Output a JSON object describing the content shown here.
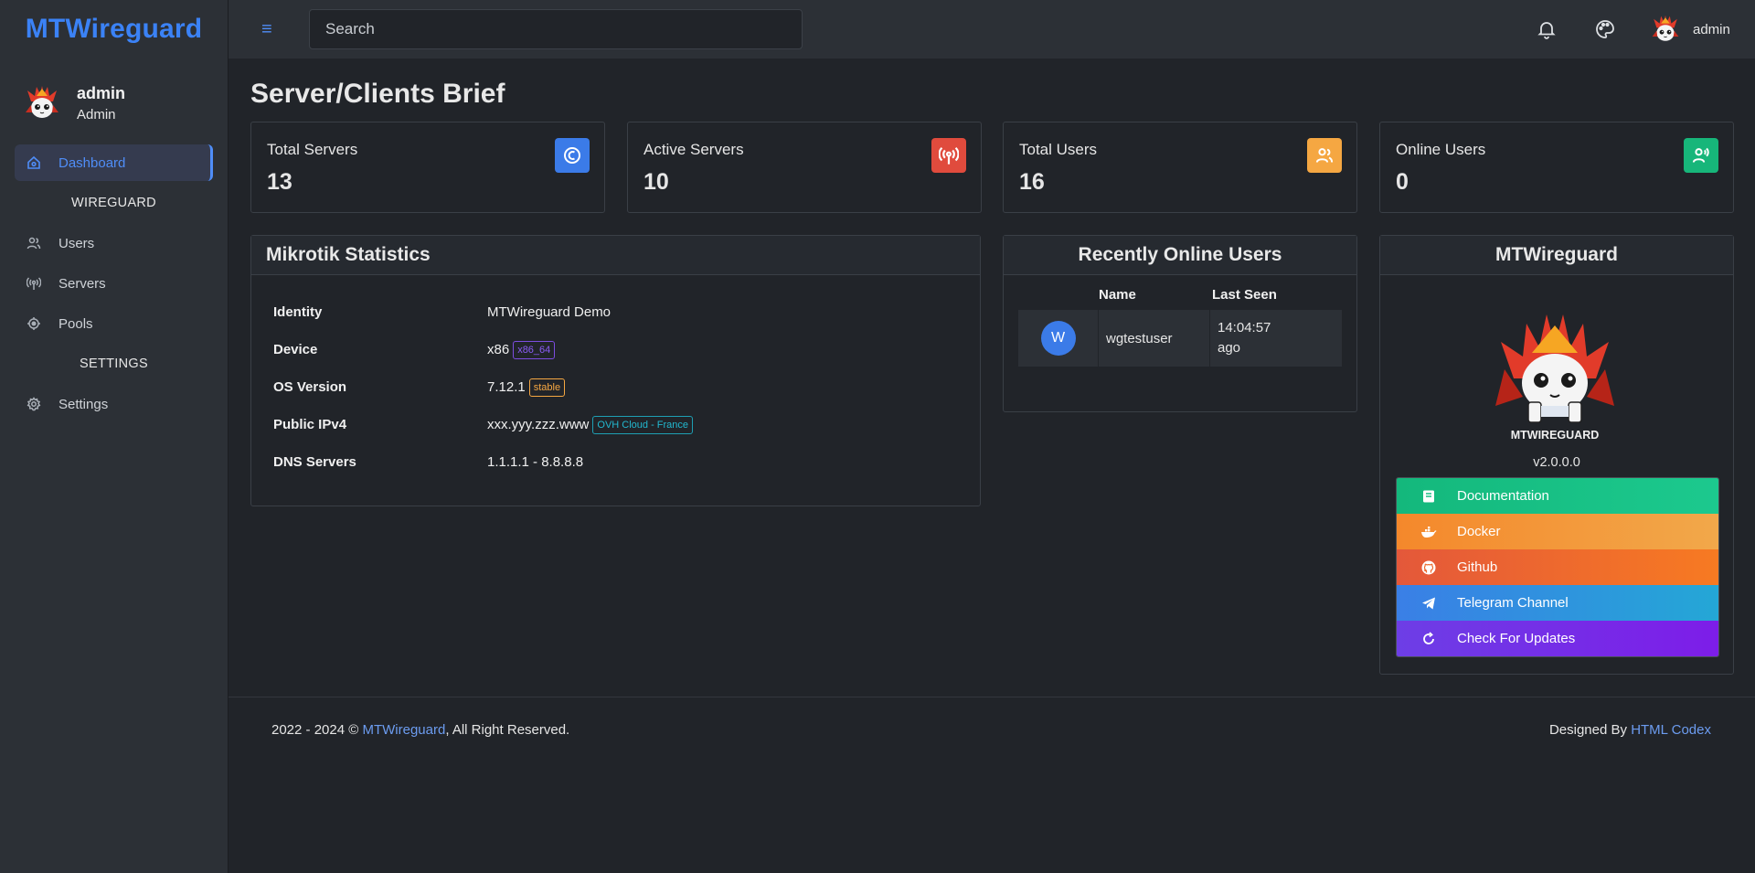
{
  "brand": "MTWireguard",
  "colors": {
    "accent": "#3b82f6",
    "bg": "#212429",
    "panel": "#2c3036"
  },
  "profile": {
    "name": "admin",
    "role": "Admin"
  },
  "nav": {
    "dashboard": "Dashboard",
    "section_wireguard": "WIREGUARD",
    "users": "Users",
    "servers": "Servers",
    "pools": "Pools",
    "section_settings": "SETTINGS",
    "settings": "Settings"
  },
  "topbar": {
    "menu_icon": "≡",
    "search_placeholder": "Search",
    "user": "admin"
  },
  "page_title": "Server/Clients Brief",
  "stats": [
    {
      "label": "Total Servers",
      "value": "13",
      "color": "#3b7be8",
      "icon": "clock-icon"
    },
    {
      "label": "Active Servers",
      "value": "10",
      "color": "#e04b3d",
      "icon": "broadcast-icon"
    },
    {
      "label": "Total Users",
      "value": "16",
      "color": "#f5a742",
      "icon": "users-icon"
    },
    {
      "label": "Online Users",
      "value": "0",
      "color": "#17b67a",
      "icon": "user-voice-icon"
    }
  ],
  "mikrotik": {
    "title": "Mikrotik Statistics",
    "rows": [
      {
        "key": "Identity",
        "value": "MTWireguard Demo",
        "tag": ""
      },
      {
        "key": "Device",
        "value": "x86",
        "tag": "x86_64"
      },
      {
        "key": "OS Version",
        "value": "7.12.1",
        "tag": "stable"
      },
      {
        "key": "Public IPv4",
        "value": "xxx.yyy.zzz.www",
        "tag": "OVH Cloud - France"
      },
      {
        "key": "DNS Servers",
        "value": "1.1.1.1 - 8.8.8.8",
        "tag": ""
      }
    ]
  },
  "recent": {
    "title": "Recently Online Users",
    "col_name": "Name",
    "col_last_seen": "Last Seen",
    "rows": [
      {
        "initial": "W",
        "name": "wgtestuser",
        "last_seen_1": "14:04:57",
        "last_seen_2": "ago"
      }
    ]
  },
  "about": {
    "title": "MTWireguard",
    "logo_text": "MTWIREGUARD",
    "version": "v2.0.0.0",
    "links": {
      "documentation": "Documentation",
      "docker": "Docker",
      "github": "Github",
      "telegram": "Telegram Channel",
      "updates": "Check For Updates"
    }
  },
  "footer": {
    "years": "2022 - 2024 ©",
    "brand_link": "MTWireguard",
    "rights": ", All Right Reserved.",
    "designed_by": "Designed By",
    "designer_link": "HTML Codex"
  }
}
